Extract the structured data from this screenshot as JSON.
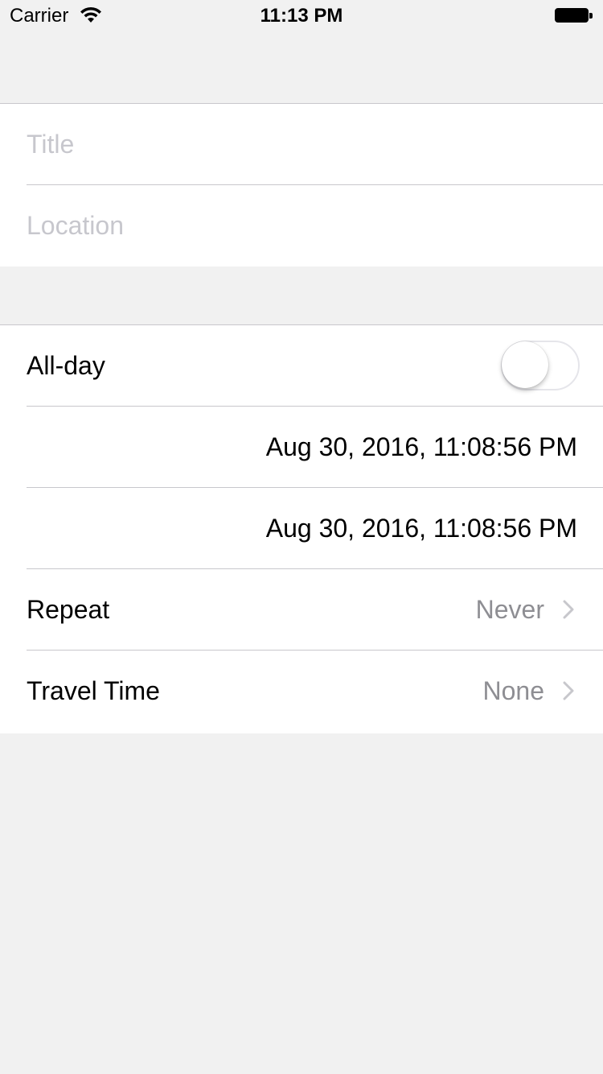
{
  "status_bar": {
    "carrier": "Carrier",
    "time": "11:13 PM",
    "wifi_icon": "wifi-icon",
    "battery_icon": "battery-icon"
  },
  "event_form": {
    "title": {
      "placeholder": "Title",
      "value": ""
    },
    "location": {
      "placeholder": "Location",
      "value": ""
    },
    "all_day": {
      "label": "All-day",
      "enabled": false
    },
    "start_date": "Aug 30, 2016, 11:08:56 PM",
    "end_date": "Aug 30, 2016, 11:08:56 PM",
    "repeat": {
      "label": "Repeat",
      "value": "Never"
    },
    "travel_time": {
      "label": "Travel Time",
      "value": "None"
    }
  },
  "colors": {
    "background": "#efeff4",
    "separator": "#c8c7cc",
    "placeholder": "#c7c7cd",
    "secondary_text": "#8e8e93"
  }
}
